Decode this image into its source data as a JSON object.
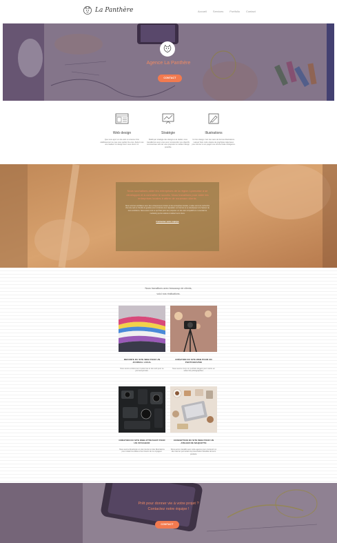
{
  "nav": {
    "brand": "La Panthère",
    "links": [
      "Accueil",
      "Services",
      "Portfolio",
      "Contact"
    ]
  },
  "hero": {
    "title": "Agence La Panthère",
    "button": "CONTACT"
  },
  "services": [
    {
      "icon": "web-design-icon",
      "title": "Web design",
      "desc": "Que vous ayez un site web ou à lancer d'un établissement ou que vous parliez de vous, flairez mes une réalisez un design dont vous rêvez. Ici."
    },
    {
      "icon": "strategy-chart-icon",
      "title": "Stratégie",
      "desc": "Établi par stratégie des designs à la réalité, nous travaillerons avec vous pour comprendre vos objectifs commerciaux afin de vous proposer le meilleur design possible."
    },
    {
      "icon": "illustration-icon",
      "title": "Illustrations",
      "desc": "Un bon design n'est rien sans de bonnes illustrations. Laissez faire notre équipe de graphistes talentueux pour donner à vos pages une touche finale d'élégance."
    }
  ],
  "mission": {
    "heading": "Nous souhaitons aider les entreprises de la région Lyonnaise à se développer et à connaître le succès. Nous travaillons pour aider les entreprises locales à attirer de nouveaux clients.",
    "body": "Nous sommes ambitieux avec des entrepreneurs locaux et des entreprises locales, si elles sont à la recherche d'un site web et d'outils de gestion pour construire leur réputation sur Internet et se développer à la hauteur de leurs ambitions. Nous avons tout ce qu'il faut pour leur proposer un site web compétitif et un éventail de marketing qui les aidera à réaliser leurs rêves.",
    "link": "Contactez notre équipe"
  },
  "portfolio": {
    "intro_line1": "Nous travaillons avec beaucoup de clients,",
    "intro_line2": "voici nos réalisations.",
    "cards": [
      {
        "title": "REFONTE DU SITE WEB POUR UN JOURNAL LOCAL",
        "desc": "Nous avons entièrement modernisé le site web pour ce journal lyonnais."
      },
      {
        "title": "CRÉATION DU SITE WEB POUR UN PHOTOGRAPHE",
        "desc": "Nous avons conçu un portfolio élégant pour mettre en valeur les photographies."
      },
      {
        "title": "CRÉATION DU SITE WEB ATTRAYANT POUR UN VOYAGEUR",
        "desc": "Nous avons développé un site internet et des illustrations pour relater les aléas et les trésors de ce voyageur."
      },
      {
        "title": "CONCEPTION DU SITE WEB POUR UN ATELIER DE MAQUETTE",
        "desc": "Nous avons travaillé avec cette agence pour concevoir un site internet permettant la présentation détaillée de leurs produits."
      }
    ]
  },
  "cta": {
    "line1": "Prêt pour donner vie à votre projet ?",
    "line2": "Contactez notre équipe !",
    "button": "CONTACT"
  },
  "colors": {
    "accent": "#f27a4f",
    "hero_overlay": "#4b375a",
    "mission_box": "#96784",
    "text": "#555555"
  }
}
